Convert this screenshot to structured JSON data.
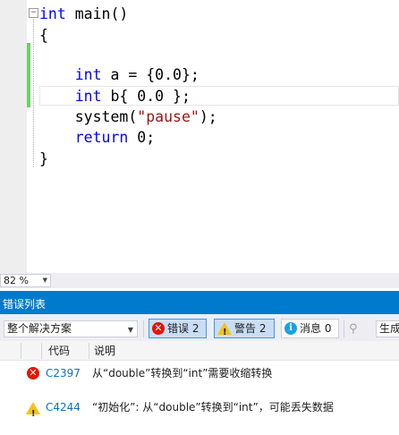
{
  "editor": {
    "lines": [
      [
        {
          "t": "int",
          "c": "kw"
        },
        {
          "t": " main()",
          "c": ""
        }
      ],
      [
        {
          "t": "{",
          "c": ""
        }
      ],
      [
        {
          "t": "",
          "c": ""
        }
      ],
      [
        {
          "t": "    ",
          "c": ""
        },
        {
          "t": "int",
          "c": "kw"
        },
        {
          "t": " a = {0.0};",
          "c": ""
        }
      ],
      [
        {
          "t": "    ",
          "c": ""
        },
        {
          "t": "int",
          "c": "kw"
        },
        {
          "t": " b{ 0.0 };",
          "c": ""
        }
      ],
      [
        {
          "t": "    system(",
          "c": ""
        },
        {
          "t": "\"pause\"",
          "c": "str"
        },
        {
          "t": ");",
          "c": ""
        }
      ],
      [
        {
          "t": "    ",
          "c": ""
        },
        {
          "t": "return",
          "c": "kw"
        },
        {
          "t": " 0;",
          "c": ""
        }
      ],
      [
        {
          "t": "}",
          "c": ""
        }
      ]
    ],
    "fold_glyph": "−",
    "zoom": "82 %"
  },
  "error_list": {
    "title": "错误列表",
    "scope": "整个解决方案",
    "errors_button": "错误 2",
    "warnings_button": "警告 2",
    "messages_button": "消息 0",
    "build_filter": "生成",
    "columns": {
      "code": "代码",
      "description": "说明"
    },
    "rows": [
      {
        "type": "error",
        "code": "C2397",
        "description": "从“double”转换到“int”需要收缩转换"
      },
      {
        "type": "warning",
        "code": "C4244",
        "description": "“初始化”: 从“double”转换到“int”，可能丢失数据"
      }
    ]
  },
  "colors": {
    "keyword": "#0000ff",
    "string": "#a31515",
    "accent": "#007acc",
    "error": "#e51400",
    "warning": "#f5c21a"
  },
  "icons": {
    "error": "error-circle-icon",
    "warning": "warning-triangle-icon",
    "info": "info-circle-icon",
    "build_filter": "build-filter-icon"
  }
}
